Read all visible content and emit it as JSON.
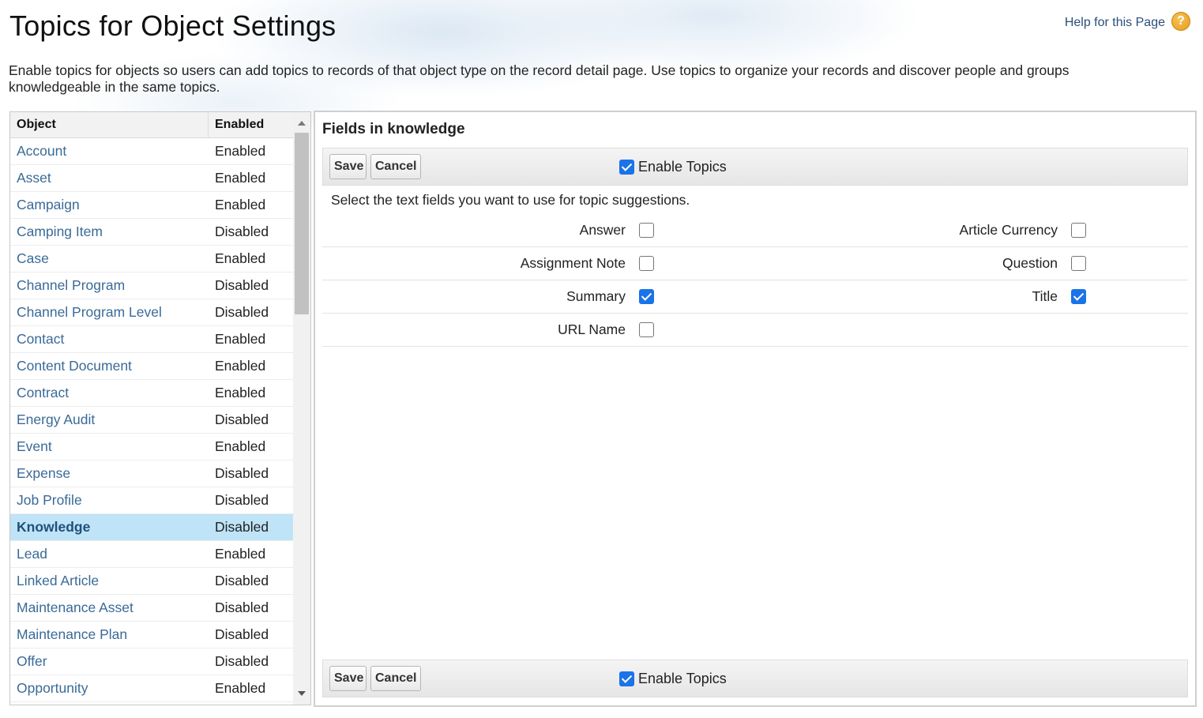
{
  "page": {
    "title": "Topics for Object Settings",
    "help_link": "Help for this Page",
    "help_icon": "question-mark-icon",
    "help_icon_glyph": "?",
    "description": "Enable topics for objects so users can add topics to records of that object type on the record detail page. Use topics to organize your records and discover people and groups knowledgeable in the same topics."
  },
  "object_list": {
    "header_object": "Object",
    "header_enabled": "Enabled",
    "rows": [
      {
        "name": "Account",
        "status": "Enabled"
      },
      {
        "name": "Asset",
        "status": "Enabled"
      },
      {
        "name": "Campaign",
        "status": "Enabled"
      },
      {
        "name": "Camping Item",
        "status": "Disabled"
      },
      {
        "name": "Case",
        "status": "Enabled"
      },
      {
        "name": "Channel Program",
        "status": "Disabled"
      },
      {
        "name": "Channel Program Level",
        "status": "Disabled"
      },
      {
        "name": "Contact",
        "status": "Enabled"
      },
      {
        "name": "Content Document",
        "status": "Enabled"
      },
      {
        "name": "Contract",
        "status": "Enabled"
      },
      {
        "name": "Energy Audit",
        "status": "Disabled"
      },
      {
        "name": "Event",
        "status": "Enabled"
      },
      {
        "name": "Expense",
        "status": "Disabled"
      },
      {
        "name": "Job Profile",
        "status": "Disabled"
      },
      {
        "name": "Knowledge",
        "status": "Disabled",
        "selected": true
      },
      {
        "name": "Lead",
        "status": "Enabled"
      },
      {
        "name": "Linked Article",
        "status": "Disabled"
      },
      {
        "name": "Maintenance Asset",
        "status": "Disabled"
      },
      {
        "name": "Maintenance Plan",
        "status": "Disabled"
      },
      {
        "name": "Offer",
        "status": "Disabled"
      },
      {
        "name": "Opportunity",
        "status": "Enabled"
      }
    ]
  },
  "fields_panel": {
    "title": "Fields in knowledge",
    "save_label": "Save",
    "cancel_label": "Cancel",
    "enable_topics_label": "Enable Topics",
    "enable_topics_checked": true,
    "instructions": "Select the text fields you want to use for topic suggestions.",
    "fields_left": [
      {
        "label": "Answer",
        "checked": false
      },
      {
        "label": "Assignment Note",
        "checked": false
      },
      {
        "label": "Summary",
        "checked": true
      },
      {
        "label": "URL Name",
        "checked": false
      }
    ],
    "fields_right": [
      {
        "label": "Article Currency",
        "checked": false
      },
      {
        "label": "Question",
        "checked": false
      },
      {
        "label": "Title",
        "checked": true
      }
    ]
  },
  "colors": {
    "link": "#3a6a97",
    "selected_row": "#bfe3f7",
    "checkbox_checked": "#1a73e8",
    "help_icon": "#e9a12a"
  }
}
